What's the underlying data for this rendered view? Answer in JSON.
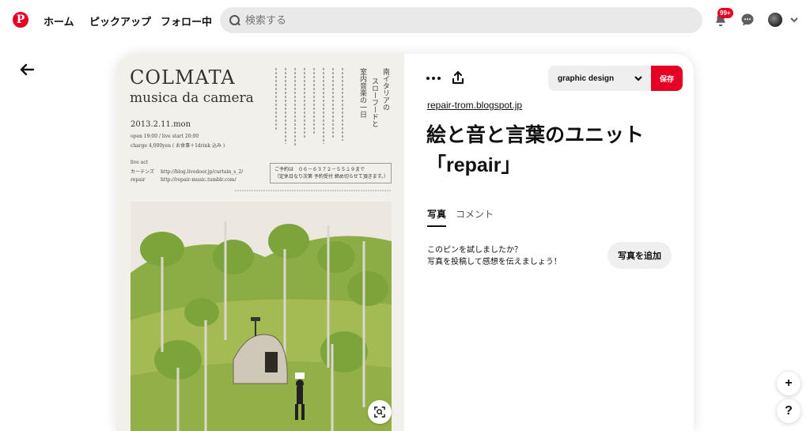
{
  "header": {
    "nav": [
      {
        "label": "ホーム"
      },
      {
        "label": "ピックアップ"
      },
      {
        "label": "フォロー中"
      }
    ],
    "search_placeholder": "検索する",
    "notifications_badge": "99+"
  },
  "pin": {
    "poster": {
      "title": "COLMATA",
      "subtitle": "musica da camera",
      "date": "2013.2.11.mon",
      "time_line": "open 19:00 / live start 20:00",
      "charge_line": "charge 4,000yen ( お食事＋1drink 込み )",
      "live_act": "live act",
      "act1_name": "カーテンズ",
      "act1_url": "http://blog.livedoor.jp/curtain_s_2/",
      "act2_name": "repair",
      "act2_url": "http://repair-music.tumblr.com/",
      "reserve_line1": "ご予約は　０６－６３７２－５５１９まで",
      "reserve_line2": "（定休日なり次第 予約受付 締め切らせて頂きます。）",
      "vertical1": "南イタリアの",
      "vertical2": "スローフードと",
      "vertical3": "室内音楽の一日"
    },
    "source": "repair-trom.blogspot.jp",
    "title": "絵と音と言葉のユニット「repair」",
    "board": "graphic design",
    "save_label": "保存",
    "tabs": [
      {
        "label": "写真"
      },
      {
        "label": "コメント"
      }
    ],
    "tried_question": "このピンを試しましたか？",
    "tried_prompt": "写真を投稿して感想を伝えましょう！",
    "add_photo_label": "写真を追加"
  },
  "floating": {
    "plus": "+",
    "help": "?"
  },
  "colors": {
    "brand": "#e60023",
    "search_bg": "#e9e9e9",
    "chip_bg": "#efefef"
  }
}
